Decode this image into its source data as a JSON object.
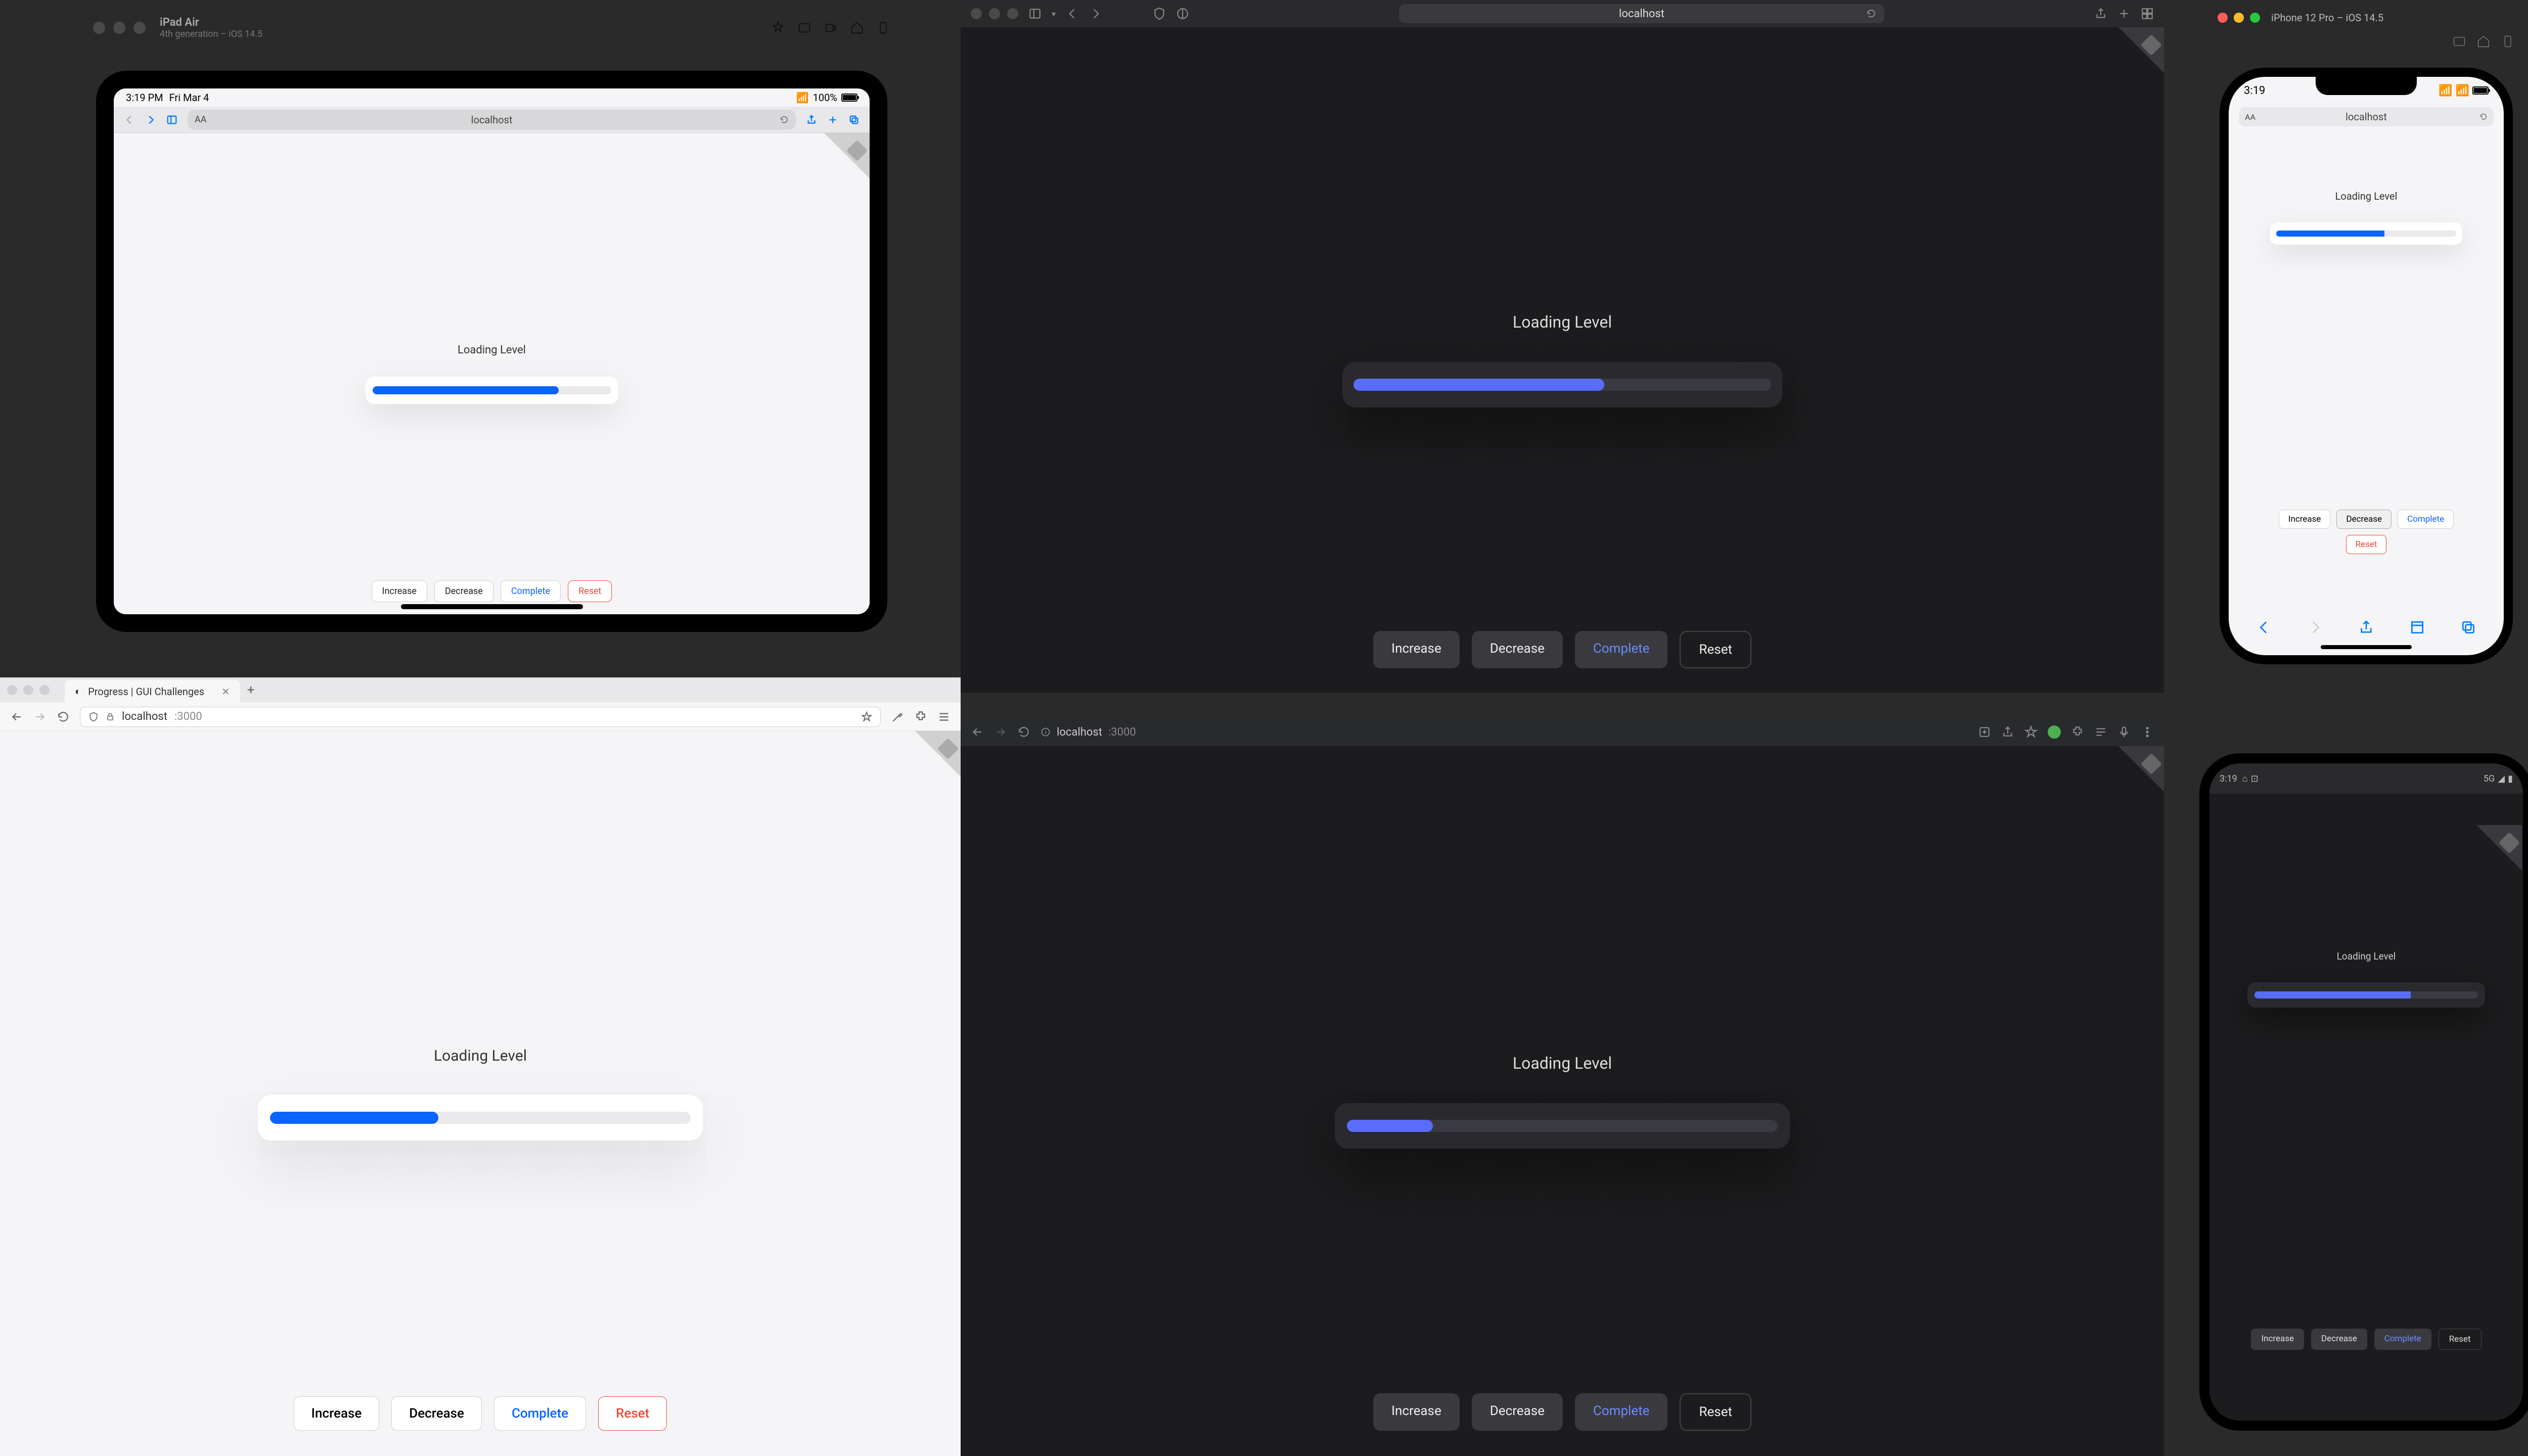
{
  "app": {
    "loading_label": "Loading Level",
    "buttons": {
      "increase": "Increase",
      "decrease": "Decrease",
      "complete": "Complete",
      "reset": "Reset"
    }
  },
  "colors": {
    "accent_light": "#0a64ff",
    "accent_dark": "#5a6cff",
    "danger": "#e74c3c"
  },
  "ipad_sim": {
    "device_name": "iPad Air",
    "device_subtitle": "4th generation – iOS 14.5",
    "status_time": "3:19 PM",
    "status_date": "Fri Mar 4",
    "wifi": "100%",
    "url": "localhost",
    "progress_pct": 78
  },
  "safari": {
    "url": "localhost",
    "progress_pct": 60
  },
  "iphone_sim": {
    "device_name": "iPhone 12 Pro – iOS 14.5",
    "status_time": "3:19",
    "url": "localhost",
    "progress_pct": 60
  },
  "firefox": {
    "tab_title": "Progress | GUI Challenges",
    "url_host": "localhost",
    "url_port": ":3000",
    "progress_pct": 40
  },
  "chrome": {
    "url_host": "localhost",
    "url_port": ":3000",
    "progress_pct": 20
  },
  "android": {
    "status_time": "3:19",
    "progress_pct": 70
  }
}
